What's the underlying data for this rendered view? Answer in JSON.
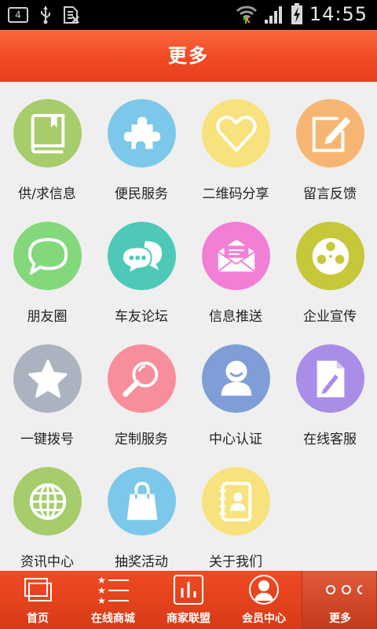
{
  "statusbar": {
    "badge": "4",
    "time": "14:55"
  },
  "header": {
    "title": "更多"
  },
  "grid": [
    {
      "label": "供/求信息",
      "icon": "book-icon",
      "color": "#a7cc6b"
    },
    {
      "label": "便民服务",
      "icon": "puzzle-icon",
      "color": "#7cc8ea"
    },
    {
      "label": "二维码分享",
      "icon": "heart-icon",
      "color": "#f8e27d"
    },
    {
      "label": "留言反馈",
      "icon": "edit-note-icon",
      "color": "#f7b574"
    },
    {
      "label": "朋友圈",
      "icon": "speech-bubble-icon",
      "color": "#83d87c"
    },
    {
      "label": "车友论坛",
      "icon": "chat-bubbles-icon",
      "color": "#4ec9b8"
    },
    {
      "label": "信息推送",
      "icon": "envelope-icon",
      "color": "#f27fd6"
    },
    {
      "label": "企业宣传",
      "icon": "film-reel-icon",
      "color": "#c7c73a"
    },
    {
      "label": "一键拨号",
      "icon": "star-icon",
      "color": "#aab3bf"
    },
    {
      "label": "定制服务",
      "icon": "magnifier-icon",
      "color": "#f88e9b"
    },
    {
      "label": "中心认证",
      "icon": "user-icon",
      "color": "#7f9ed8"
    },
    {
      "label": "在线客服",
      "icon": "document-edit-icon",
      "color": "#a98de8"
    },
    {
      "label": "资讯中心",
      "icon": "globe-icon",
      "color": "#a7cc6b"
    },
    {
      "label": "抽奖活动",
      "icon": "shopping-bag-icon",
      "color": "#7cc8ea"
    },
    {
      "label": "关于我们",
      "icon": "contacts-book-icon",
      "color": "#f8e27d"
    }
  ],
  "bottomnav": [
    {
      "label": "首页",
      "icon": "home-windows-icon",
      "active": false
    },
    {
      "label": "在线商城",
      "icon": "list-star-icon",
      "active": false
    },
    {
      "label": "商家联盟",
      "icon": "bar-chart-icon",
      "active": false
    },
    {
      "label": "会员中心",
      "icon": "member-avatar-icon",
      "active": false
    },
    {
      "label": "更多",
      "icon": "more-dots-icon",
      "active": true
    }
  ]
}
